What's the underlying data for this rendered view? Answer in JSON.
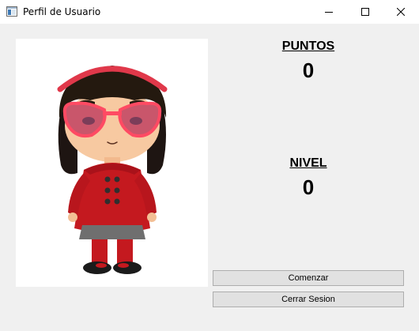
{
  "window": {
    "title": "Perfil de Usuario",
    "icon": "window-app-icon",
    "controls": [
      "minimize-icon",
      "maximize-icon",
      "close-icon"
    ]
  },
  "profile": {
    "avatar": "girl-character-avatar",
    "points_label": "PUNTOS",
    "points_value": "0",
    "level_label": "NIVEL",
    "level_value": "0"
  },
  "actions": {
    "start_label": "Comenzar",
    "logout_label": "Cerrar Sesion"
  },
  "colors": {
    "window_bg": "#f0f0f0",
    "titlebar_bg": "#ffffff",
    "button_bg": "#e1e1e1",
    "button_border": "#adadad"
  }
}
